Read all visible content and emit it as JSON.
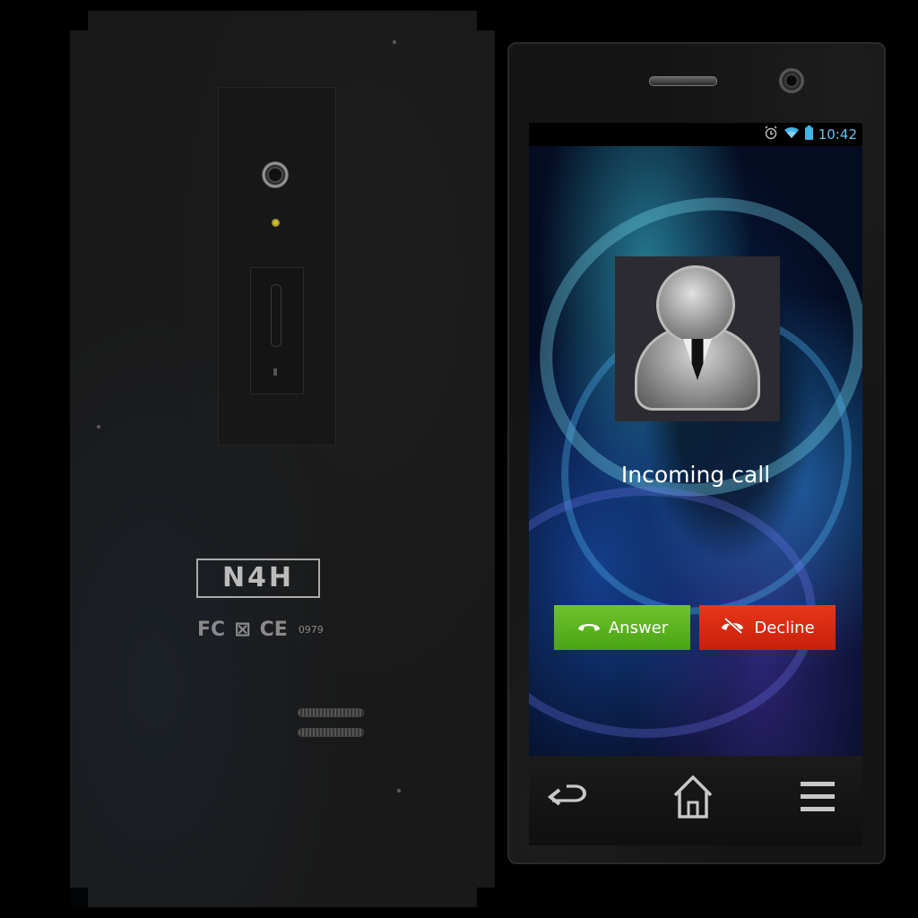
{
  "back": {
    "brand": "N4H",
    "cert_marks": [
      "FC",
      "⊠",
      "CE"
    ],
    "cert_number": "0979"
  },
  "status_bar": {
    "time": "10:42",
    "icons": [
      "alarm-icon",
      "wifi-icon",
      "battery-icon"
    ]
  },
  "call": {
    "title": "Incoming call",
    "answer_label": "Answer",
    "decline_label": "Decline"
  },
  "nav": {
    "buttons": [
      "back-icon",
      "home-icon",
      "menu-icon"
    ]
  },
  "colors": {
    "answer": "#58b21f",
    "decline": "#d62a12",
    "status_accent": "#5ec6f4"
  }
}
